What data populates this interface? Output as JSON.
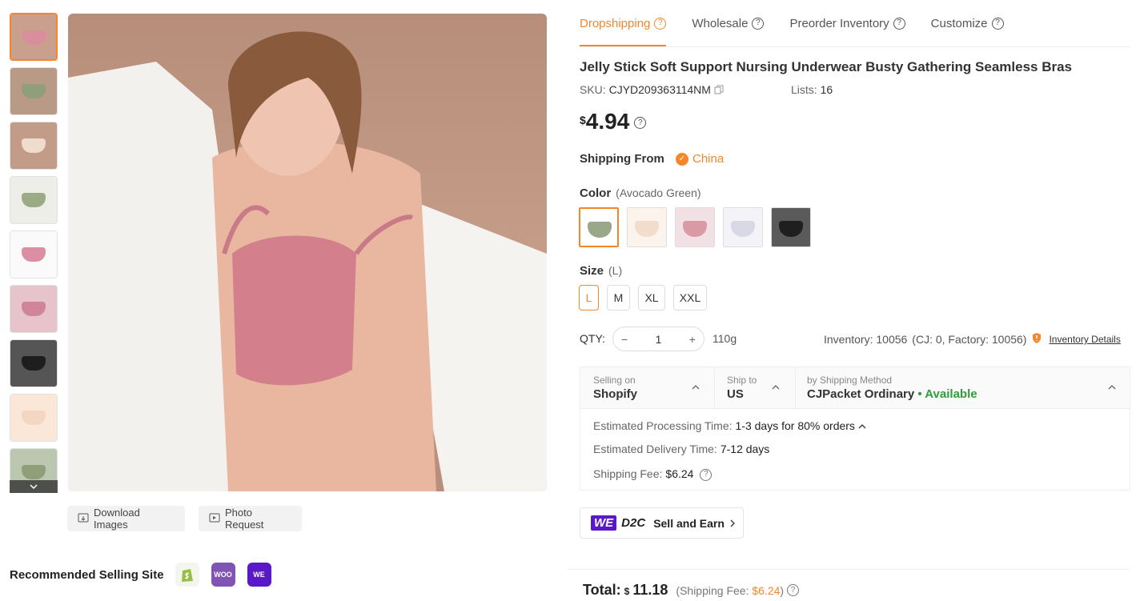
{
  "tabs": [
    {
      "label": "Dropshipping",
      "active": true
    },
    {
      "label": "Wholesale"
    },
    {
      "label": "Preorder Inventory"
    },
    {
      "label": "Customize"
    }
  ],
  "product": {
    "title": "Jelly Stick Soft Support Nursing Underwear Busty Gathering Seamless Bras",
    "sku_label": "SKU:",
    "sku": "CJYD209363114NM",
    "lists_label": "Lists:",
    "lists": "16",
    "currency": "$",
    "price": "4.94"
  },
  "shipping_from": {
    "label": "Shipping From",
    "value": "China"
  },
  "color": {
    "label": "Color",
    "selected": "(Avocado Green)",
    "swatches": [
      {
        "name": "Avocado Green",
        "color": "#9aa88a",
        "selected": true
      },
      {
        "name": "Beige",
        "color": "#f2dccb"
      },
      {
        "name": "Pink",
        "color": "#d99aa6"
      },
      {
        "name": "Light Purple",
        "color": "#d9d9e6"
      },
      {
        "name": "Black",
        "color": "#2a2a2a"
      }
    ]
  },
  "size": {
    "label": "Size",
    "selected": "(L)",
    "options": [
      "L",
      "M",
      "XL",
      "XXL"
    ]
  },
  "qty": {
    "label": "QTY:",
    "value": "1",
    "weight": "110g",
    "inventory": "Inventory: 10056",
    "inventory_breakdown": "(CJ: 0, Factory: 10056)",
    "inventory_link": "Inventory Details"
  },
  "shipping": {
    "selling_on_label": "Selling on",
    "selling_on": "Shopify",
    "ship_to_label": "Ship to",
    "ship_to": "US",
    "method_label": "by Shipping Method",
    "method": "CJPacket Ordinary",
    "availability": "• Available",
    "processing_label": "Estimated Processing Time:",
    "processing": "1-3 days for 80% orders",
    "delivery_label": "Estimated Delivery Time:",
    "delivery": "7-12 days",
    "fee_label": "Shipping Fee:",
    "fee": "$6.24"
  },
  "d2c": {
    "we": "WE",
    "d2c": "D2C",
    "label": "Sell and Earn"
  },
  "total": {
    "label": "Total:",
    "currency": "$",
    "value": "11.18",
    "fee_prefix": "(Shipping Fee:",
    "fee": "$6.24",
    "fee_suffix": ")"
  },
  "gallery": {
    "download": "Download Images",
    "photo_request": "Photo Request"
  },
  "recommended": {
    "label": "Recommended Selling Site",
    "sites": [
      "Shopify",
      "WooCommerce",
      "WE D2C"
    ]
  },
  "colors": {
    "accent": "#f5862b",
    "available": "#2e9d3a",
    "we_brand": "#5a19c8"
  }
}
